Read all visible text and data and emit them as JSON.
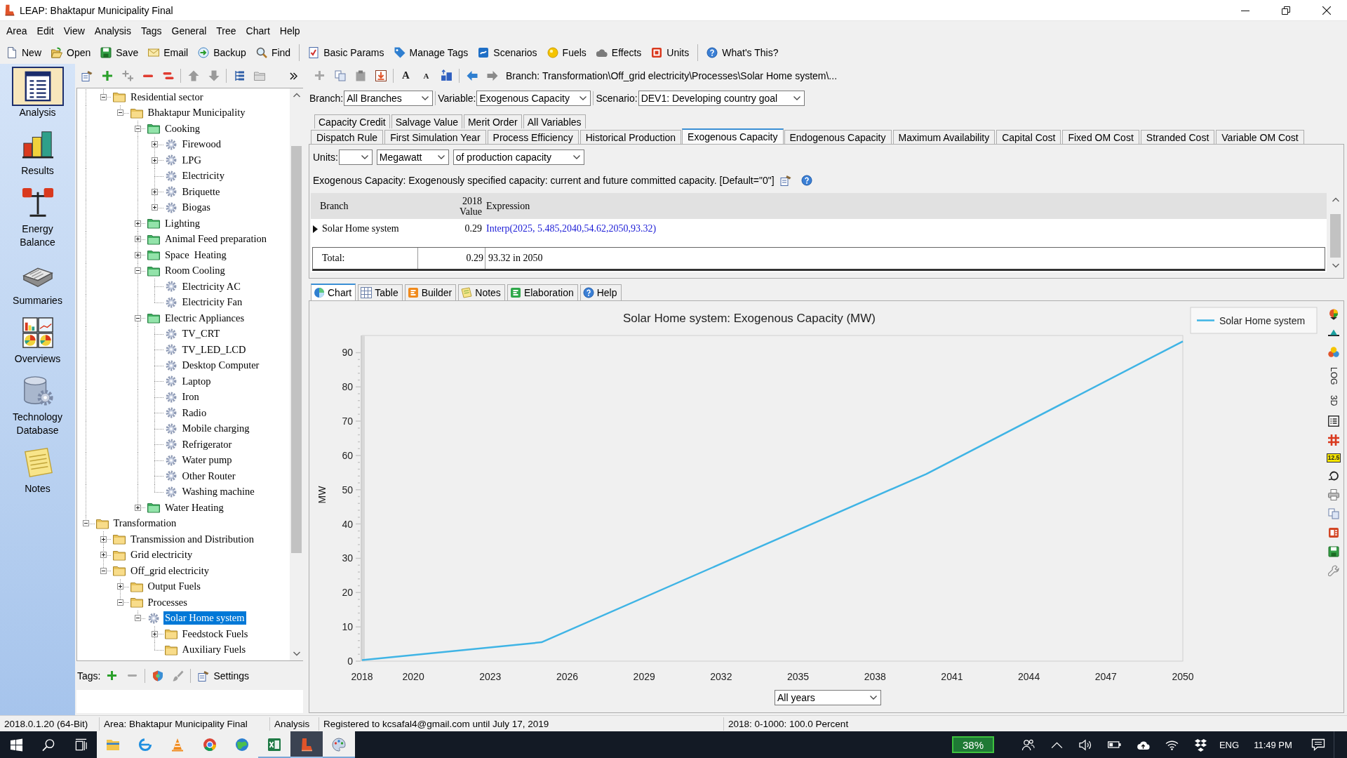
{
  "window": {
    "title": "LEAP: Bhaktapur Municipality Final"
  },
  "menu": [
    "Area",
    "Edit",
    "View",
    "Analysis",
    "Tags",
    "General",
    "Tree",
    "Chart",
    "Help"
  ],
  "toolbar": [
    {
      "items": [
        {
          "label": "New",
          "kind": "new"
        },
        {
          "label": "Open",
          "kind": "open"
        },
        {
          "label": "Save",
          "kind": "save"
        },
        {
          "label": "Email",
          "kind": "email"
        },
        {
          "label": "Backup",
          "kind": "backup"
        },
        {
          "label": "Find",
          "kind": "find"
        }
      ]
    },
    {
      "items": [
        {
          "label": "Basic Params",
          "kind": "params"
        },
        {
          "label": "Manage Tags",
          "kind": "tags"
        },
        {
          "label": "Scenarios",
          "kind": "scenarios"
        },
        {
          "label": "Fuels",
          "kind": "fuels"
        },
        {
          "label": "Effects",
          "kind": "effects"
        },
        {
          "label": "Units",
          "kind": "units"
        }
      ]
    },
    {
      "items": [
        {
          "label": "What's This?",
          "kind": "whatsthis"
        }
      ]
    }
  ],
  "sidebar": {
    "items": [
      {
        "label": "Analysis",
        "kind": "analysis",
        "selected": true
      },
      {
        "label": "Results",
        "kind": "results",
        "selected": false
      },
      {
        "label": "Energy Balance",
        "kind": "balance",
        "selected": false
      },
      {
        "label": "Summaries",
        "kind": "summaries",
        "selected": false
      },
      {
        "label": "Overviews",
        "kind": "overviews",
        "selected": false
      },
      {
        "label": "Technology Database",
        "kind": "techdb",
        "selected": false
      },
      {
        "label": "Notes",
        "kind": "notes",
        "selected": false
      }
    ]
  },
  "tree": {
    "items": [
      {
        "children": [
          {
            "label": "Residential sector",
            "kind": "folder",
            "expanded": true,
            "selected": false,
            "children": [
              {
                "label": "Bhaktapur Municipality",
                "kind": "folder",
                "expanded": true,
                "selected": false,
                "children": [
                  {
                    "label": "Cooking",
                    "kind": "category",
                    "expanded": true,
                    "selected": false,
                    "children": [
                      {
                        "label": "Firewood",
                        "kind": "technology",
                        "expanded": false,
                        "selected": false
                      },
                      {
                        "label": "LPG",
                        "kind": "technology",
                        "expanded": false,
                        "selected": false
                      },
                      {
                        "label": "Electricity",
                        "kind": "technology",
                        "selected": false
                      },
                      {
                        "label": "Briquette",
                        "kind": "technology",
                        "expanded": false,
                        "selected": false
                      },
                      {
                        "label": "Biogas",
                        "kind": "technology",
                        "expanded": false,
                        "selected": false
                      }
                    ]
                  },
                  {
                    "label": "Lighting",
                    "kind": "category",
                    "expanded": false,
                    "selected": false
                  },
                  {
                    "label": "Animal Feed preparation",
                    "kind": "category",
                    "expanded": false,
                    "selected": false
                  },
                  {
                    "label": "Space  Heating",
                    "kind": "category",
                    "expanded": false,
                    "selected": false
                  },
                  {
                    "label": "Room Cooling",
                    "kind": "category",
                    "expanded": true,
                    "selected": false,
                    "children": [
                      {
                        "label": "Electricity AC",
                        "kind": "technology",
                        "selected": false
                      },
                      {
                        "label": "Electricity Fan",
                        "kind": "technology",
                        "selected": false
                      }
                    ]
                  },
                  {
                    "label": "Electric Appliances",
                    "kind": "category",
                    "expanded": true,
                    "selected": false,
                    "children": [
                      {
                        "label": "TV_CRT",
                        "kind": "technology",
                        "selected": false
                      },
                      {
                        "label": "TV_LED_LCD",
                        "kind": "technology",
                        "selected": false
                      },
                      {
                        "label": "Desktop Computer",
                        "kind": "technology",
                        "selected": false
                      },
                      {
                        "label": "Laptop",
                        "kind": "technology",
                        "selected": false
                      },
                      {
                        "label": "Iron",
                        "kind": "technology",
                        "selected": false
                      },
                      {
                        "label": "Radio",
                        "kind": "technology",
                        "selected": false
                      },
                      {
                        "label": "Mobile charging",
                        "kind": "technology",
                        "selected": false
                      },
                      {
                        "label": "Refrigerator",
                        "kind": "technology",
                        "selected": false
                      },
                      {
                        "label": "Water pump",
                        "kind": "technology",
                        "selected": false
                      },
                      {
                        "label": "Other Router",
                        "kind": "technology",
                        "selected": false
                      },
                      {
                        "label": "Washing machine",
                        "kind": "technology",
                        "selected": false
                      }
                    ]
                  },
                  {
                    "label": "Water Heating",
                    "kind": "category",
                    "expanded": false,
                    "selected": false
                  }
                ]
              }
            ]
          }
        ]
      },
      {
        "label": "Transformation",
        "kind": "folder",
        "expanded": true,
        "selected": false,
        "children": [
          {
            "label": "Transmission and Distribution",
            "kind": "folder",
            "expanded": false,
            "selected": false
          },
          {
            "label": "Grid electricity",
            "kind": "folder",
            "expanded": false,
            "selected": false
          },
          {
            "label": "Off_grid electricity",
            "kind": "folder",
            "expanded": true,
            "selected": false,
            "children": [
              {
                "label": "Output Fuels",
                "kind": "folder",
                "expanded": false,
                "selected": false
              },
              {
                "label": "Processes",
                "kind": "folder",
                "expanded": true,
                "selected": false,
                "children": [
                  {
                    "label": "Solar Home system",
                    "kind": "technology",
                    "expanded": true,
                    "selected": true,
                    "children": [
                      {
                        "label": "Feedstock Fuels",
                        "kind": "folder",
                        "expanded": false,
                        "selected": false
                      },
                      {
                        "label": "Auxiliary Fuels",
                        "kind": "folder",
                        "selected": false
                      }
                    ]
                  }
                ]
              }
            ]
          }
        ]
      }
    ]
  },
  "tree_footer": {
    "label": "Tags:",
    "settings": "Settings"
  },
  "font_buttons": [
    {
      "label": "A",
      "kind": "larger"
    },
    {
      "label": "A",
      "kind": "smaller"
    }
  ],
  "branch_path": "Branch: Transformation\\Off_grid electricity\\Processes\\Solar Home system\\...",
  "selectors": [
    {
      "label": "Branch:",
      "value": "All Branches"
    },
    {
      "label": "Variable:",
      "value": "Exogenous Capacity"
    },
    {
      "label": "Scenario:",
      "value": "DEV1: Developing country goal"
    }
  ],
  "variable_tabs": [
    {
      "tabs": [
        {
          "label": "Capacity Credit",
          "selected": false
        },
        {
          "label": "Salvage Value",
          "selected": false
        },
        {
          "label": "Merit Order",
          "selected": false
        },
        {
          "label": "All Variables",
          "selected": false
        }
      ]
    },
    {
      "tabs": [
        {
          "label": "Dispatch Rule",
          "selected": false
        },
        {
          "label": "First Simulation Year",
          "selected": false
        },
        {
          "label": "Process Efficiency",
          "selected": false
        },
        {
          "label": "Historical Production",
          "selected": false
        },
        {
          "label": "Exogenous Capacity",
          "selected": true
        },
        {
          "label": "Endogenous Capacity",
          "selected": false
        },
        {
          "label": "Maximum Availability",
          "selected": false
        },
        {
          "label": "Capital Cost",
          "selected": false
        },
        {
          "label": "Fixed OM Cost",
          "selected": false
        },
        {
          "label": "Stranded Cost",
          "selected": false
        },
        {
          "label": "Variable OM Cost",
          "selected": false
        }
      ]
    }
  ],
  "units": {
    "label": "Units:",
    "selects": [
      {
        "kind": "prefix"
      },
      {
        "kind": "unit",
        "value": "Megawatt"
      },
      {
        "kind": "basis",
        "value": "of production capacity"
      }
    ]
  },
  "description": "Exogenous Capacity: Exogenously specified capacity: current and future committed capacity. [Default=\"0\"]",
  "table": {
    "columns": [
      {
        "label": "Branch"
      },
      {
        "label": "2018",
        "sublabel": "Value"
      },
      {
        "label": "Expression"
      }
    ],
    "rows": [
      {
        "branch": "Solar Home system",
        "value": "0.29",
        "expression": "Interp(2025, 5.485,2040,54.62,2050,93.32)",
        "selected": true
      }
    ],
    "total": {
      "label": "Total:",
      "value": "0.29",
      "expression": "93.32 in 2050"
    }
  },
  "view_tabs": [
    {
      "label": "Chart",
      "kind": "chart",
      "selected": true
    },
    {
      "label": "Table",
      "kind": "table",
      "selected": false
    },
    {
      "label": "Builder",
      "kind": "builder",
      "selected": false
    },
    {
      "label": "Notes",
      "kind": "notes",
      "selected": false
    },
    {
      "label": "Elaboration",
      "kind": "elaboration",
      "selected": false
    },
    {
      "label": "Help",
      "kind": "help",
      "selected": false
    }
  ],
  "chart": {
    "chart_data": {
      "type": "line",
      "title": "Solar Home system: Exogenous Capacity (MW)",
      "ylabel": "MW",
      "x": [
        2018,
        2025,
        2040,
        2050
      ],
      "series": [
        {
          "name": "Solar Home system",
          "color": "#3fb4e5",
          "values": [
            0.3,
            5.5,
            54.6,
            93.3
          ]
        }
      ],
      "xlim": [
        2018,
        2050
      ],
      "ylim": [
        0,
        95
      ],
      "xticks": [
        2018,
        2020,
        2023,
        2026,
        2029,
        2032,
        2035,
        2038,
        2041,
        2044,
        2047,
        2050
      ],
      "yticks": [
        0,
        10,
        20,
        30,
        40,
        50,
        60,
        70,
        80,
        90
      ]
    },
    "period": "All years",
    "tools": {
      "log": "LOG",
      "three_d": "3D",
      "data_labels": "12.5"
    }
  },
  "status_bar": [
    "2018.0.1.20 (64-Bit)",
    "Area: Bhaktapur Municipality Final",
    "Analysis",
    "Registered to kcsafal4@gmail.com until July 17, 2019",
    "2018: 0-1000: 100.0 Percent"
  ],
  "taskbar": {
    "apps": [
      {
        "kind": "files",
        "running": false,
        "active": false
      },
      {
        "kind": "swirl",
        "running": false,
        "active": false
      },
      {
        "kind": "cone",
        "running": false,
        "active": false
      },
      {
        "kind": "round",
        "running": false,
        "active": false
      },
      {
        "kind": "globe",
        "running": false,
        "active": false
      },
      {
        "kind": "sheet",
        "running": true,
        "active": false
      },
      {
        "kind": "boot",
        "running": true,
        "active": true
      },
      {
        "kind": "palette",
        "running": true,
        "active": false
      }
    ],
    "battery": "38%",
    "language": "ENG",
    "time": "11:49 PM"
  }
}
